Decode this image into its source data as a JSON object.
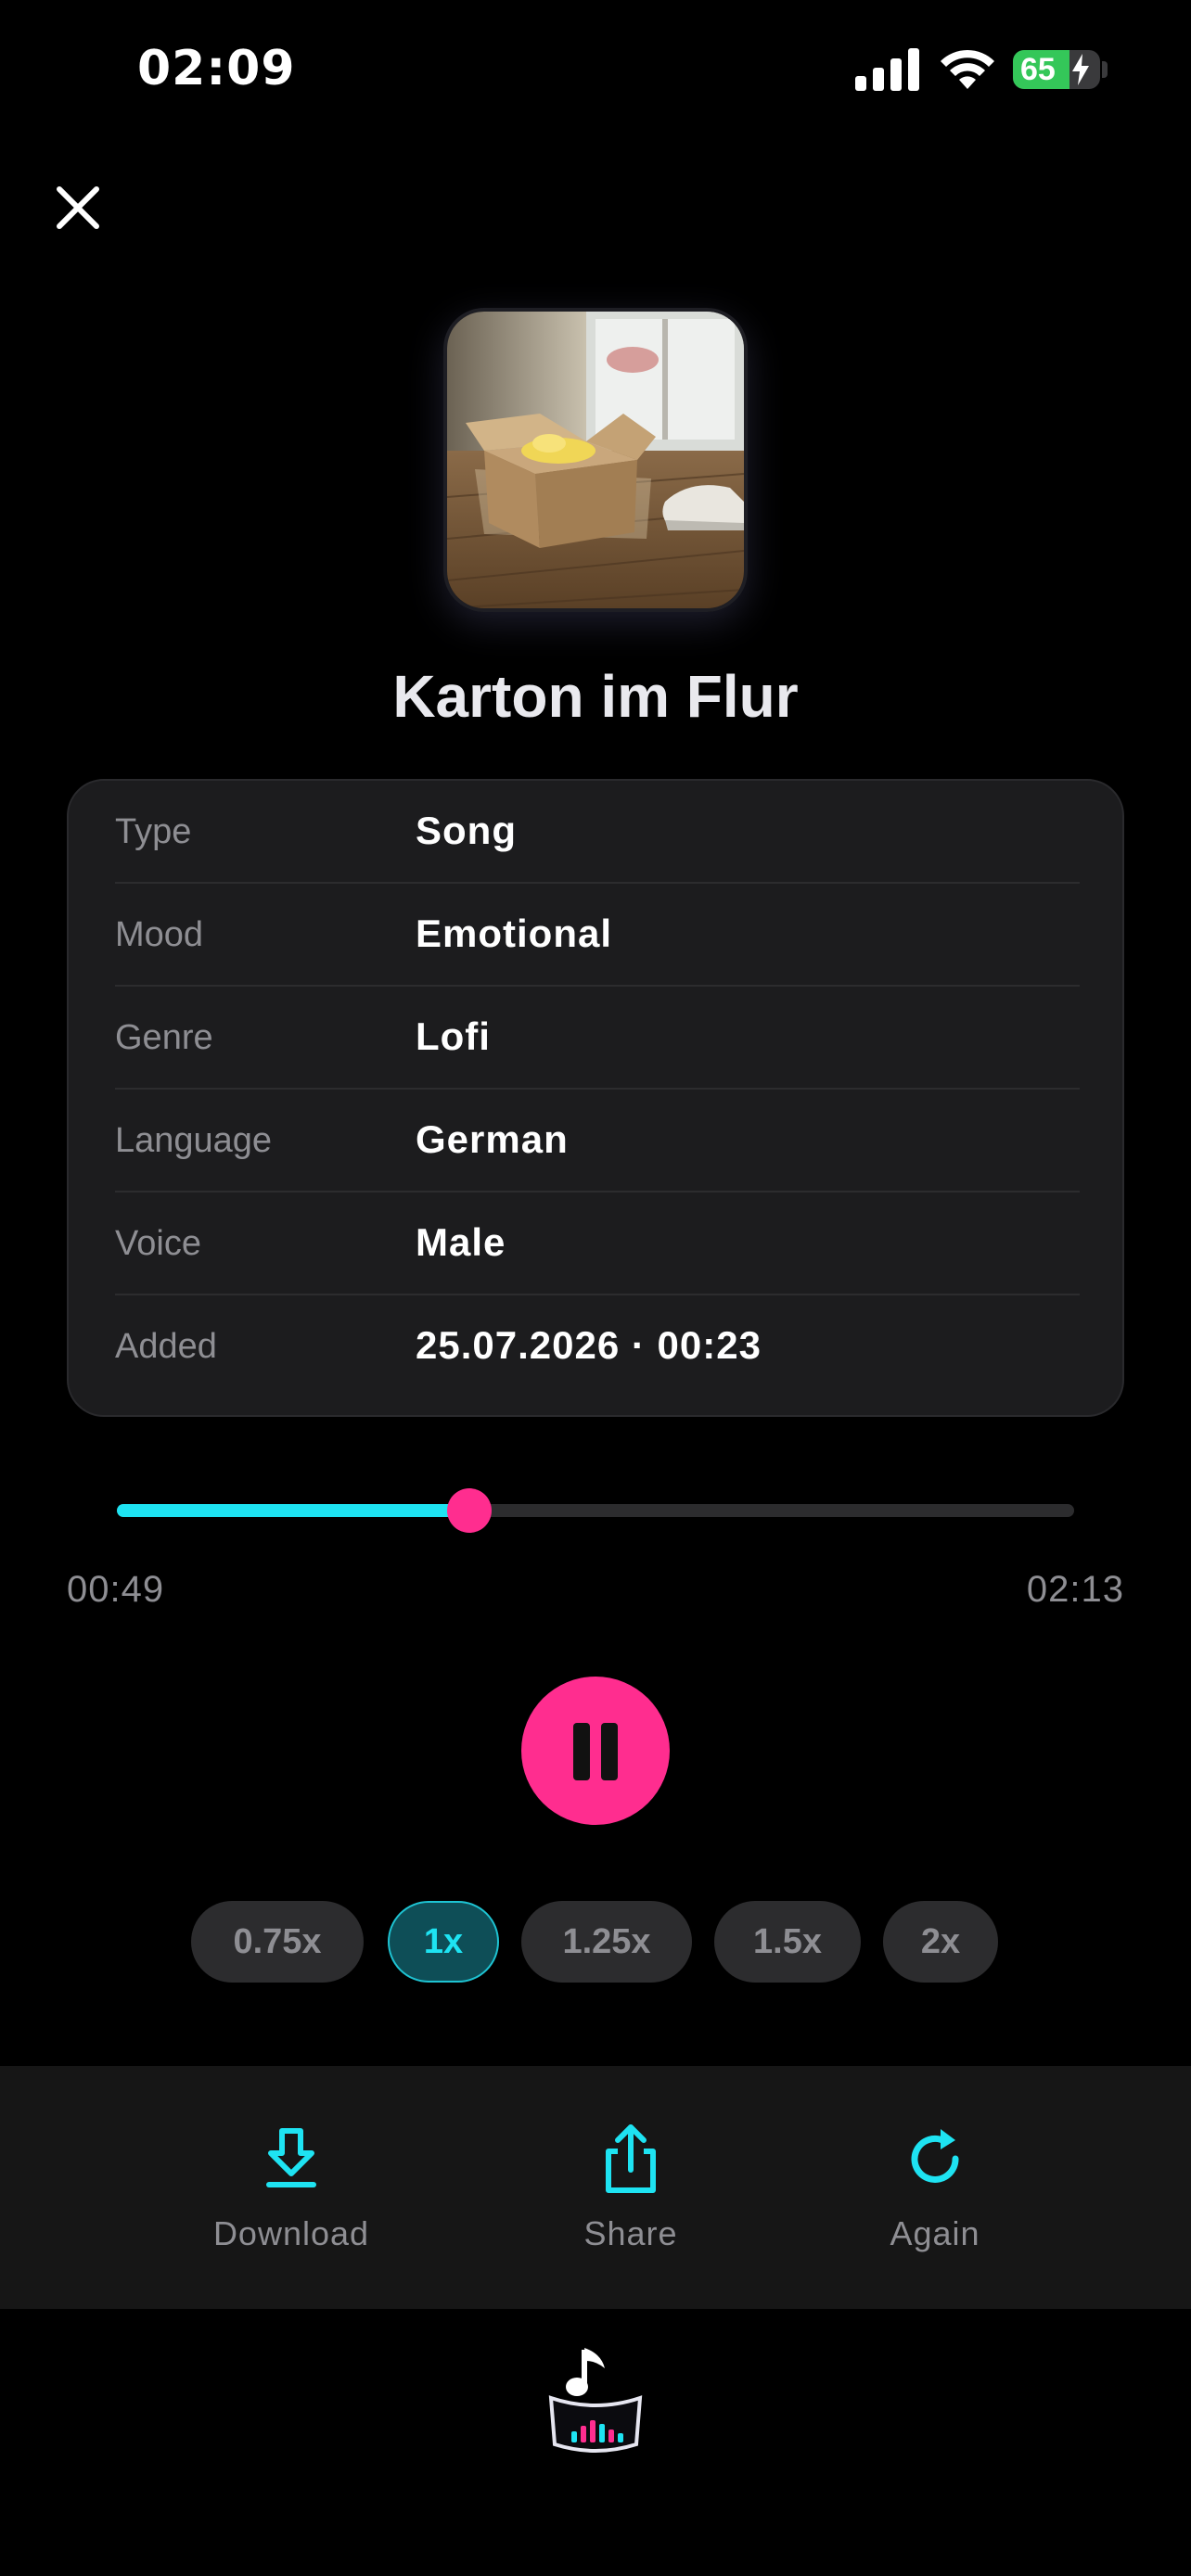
{
  "status_bar": {
    "time": "02:09",
    "battery_percent": "65",
    "battery_level": 0.65,
    "battery_charging": true,
    "battery_color": "#34c759"
  },
  "close_icon": "close-icon",
  "cover": {
    "alt_icon": "album-cover-image"
  },
  "title": "Karton im Flur",
  "info": [
    {
      "label": "Type",
      "value": "Song"
    },
    {
      "label": "Mood",
      "value": "Emotional"
    },
    {
      "label": "Genre",
      "value": "Lofi"
    },
    {
      "label": "Language",
      "value": "German"
    },
    {
      "label": "Voice",
      "value": "Male"
    },
    {
      "label": "Added",
      "value": "25.07.2026 · 00:23"
    }
  ],
  "player": {
    "current_time": "00:49",
    "total_time": "02:13",
    "progress": 0.368,
    "state": "playing",
    "accent_color": "#1ee3f2",
    "knob_color": "#ff2d8f"
  },
  "speeds": [
    {
      "label": "0.75x",
      "active": false
    },
    {
      "label": "1x",
      "active": true
    },
    {
      "label": "1.25x",
      "active": false
    },
    {
      "label": "1.5x",
      "active": false
    },
    {
      "label": "2x",
      "active": false
    }
  ],
  "actions": [
    {
      "label": "Download",
      "icon": "download-icon"
    },
    {
      "label": "Share",
      "icon": "share-icon"
    },
    {
      "label": "Again",
      "icon": "refresh-icon"
    }
  ],
  "app_logo": "music-bowl-logo"
}
